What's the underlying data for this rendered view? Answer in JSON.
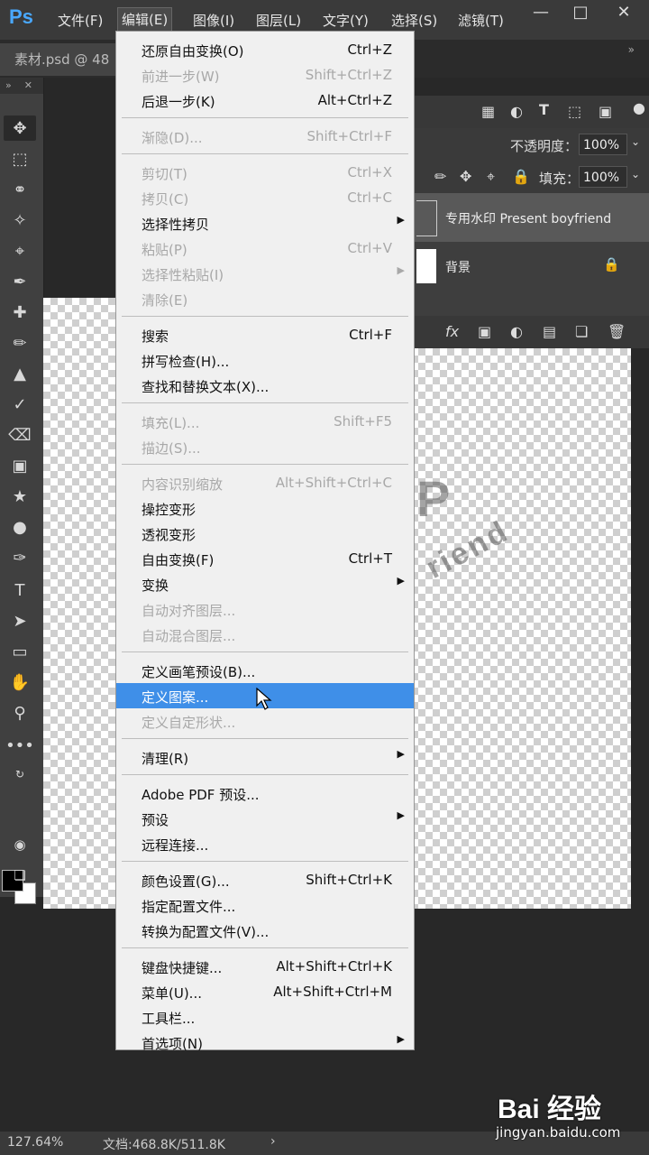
{
  "app": {
    "logo": "Ps"
  },
  "menubar": {
    "items": [
      "文件(F)",
      "编辑(E)",
      "图像(I)",
      "图层(L)",
      "文字(Y)",
      "选择(S)",
      "滤镜(T)"
    ],
    "window_controls": [
      "minimize-icon",
      "maximize-icon",
      "close-icon"
    ]
  },
  "document_tab": {
    "title": "素材.psd @ 48"
  },
  "toolbar": {
    "tools": [
      "move-icon",
      "marquee-icon",
      "lasso-icon",
      "magic-wand-icon",
      "crop-icon",
      "eyedropper-icon",
      "healing-icon",
      "brush-icon",
      "stamp-icon",
      "history-brush-icon",
      "eraser-icon",
      "gradient-icon",
      "blur-icon",
      "dodge-icon",
      "pen-icon",
      "type-icon",
      "path-selection-icon",
      "rectangle-icon",
      "hand-icon",
      "zoom-icon",
      "more-icon"
    ],
    "text_tool_label": "T",
    "foreground_color": "#000000",
    "background_color": "#ffffff"
  },
  "layers_panel": {
    "opacity_label": "不透明度：",
    "opacity_value": "100%",
    "fill_label": "填充：",
    "fill_value": "100%",
    "layers": [
      {
        "name": "专用水印 Present boyfriend",
        "selected": true
      },
      {
        "name": "背景",
        "locked": true
      }
    ]
  },
  "canvas": {
    "watermark_text": "riend"
  },
  "edit_menu": {
    "groups": [
      [
        {
          "label": "还原自由变换(O)",
          "shortcut": "Ctrl+Z",
          "enabled": true
        },
        {
          "label": "前进一步(W)",
          "shortcut": "Shift+Ctrl+Z",
          "enabled": false
        },
        {
          "label": "后退一步(K)",
          "shortcut": "Alt+Ctrl+Z",
          "enabled": true
        }
      ],
      [
        {
          "label": "渐隐(D)...",
          "shortcut": "Shift+Ctrl+F",
          "enabled": false
        }
      ],
      [
        {
          "label": "剪切(T)",
          "shortcut": "Ctrl+X",
          "enabled": false
        },
        {
          "label": "拷贝(C)",
          "shortcut": "Ctrl+C",
          "enabled": false
        },
        {
          "label": "选择性拷贝",
          "submenu": true,
          "enabled": true
        },
        {
          "label": "粘贴(P)",
          "shortcut": "Ctrl+V",
          "enabled": false
        },
        {
          "label": "选择性粘贴(I)",
          "submenu": true,
          "enabled": false
        },
        {
          "label": "清除(E)",
          "enabled": false
        }
      ],
      [
        {
          "label": "搜索",
          "shortcut": "Ctrl+F",
          "enabled": true
        },
        {
          "label": "拼写检查(H)...",
          "enabled": true
        },
        {
          "label": "查找和替换文本(X)...",
          "enabled": true
        }
      ],
      [
        {
          "label": "填充(L)...",
          "shortcut": "Shift+F5",
          "enabled": false
        },
        {
          "label": "描边(S)...",
          "enabled": false
        }
      ],
      [
        {
          "label": "内容识别缩放",
          "shortcut": "Alt+Shift+Ctrl+C",
          "enabled": false
        },
        {
          "label": "操控变形",
          "enabled": true
        },
        {
          "label": "透视变形",
          "enabled": true
        },
        {
          "label": "自由变换(F)",
          "shortcut": "Ctrl+T",
          "enabled": true
        },
        {
          "label": "变换",
          "submenu": true,
          "enabled": true
        },
        {
          "label": "自动对齐图层...",
          "enabled": false
        },
        {
          "label": "自动混合图层...",
          "enabled": false
        }
      ],
      [
        {
          "label": "定义画笔预设(B)...",
          "enabled": true
        },
        {
          "label": "定义图案...",
          "enabled": true,
          "highlighted": true
        },
        {
          "label": "定义自定形状...",
          "enabled": false
        }
      ],
      [
        {
          "label": "清理(R)",
          "submenu": true,
          "enabled": true
        }
      ],
      [
        {
          "label": "Adobe PDF 预设...",
          "enabled": true
        },
        {
          "label": "预设",
          "submenu": true,
          "enabled": true
        },
        {
          "label": "远程连接...",
          "enabled": true
        }
      ],
      [
        {
          "label": "颜色设置(G)...",
          "shortcut": "Shift+Ctrl+K",
          "enabled": true
        },
        {
          "label": "指定配置文件...",
          "enabled": true
        },
        {
          "label": "转换为配置文件(V)...",
          "enabled": true
        }
      ],
      [
        {
          "label": "键盘快捷键...",
          "shortcut": "Alt+Shift+Ctrl+K",
          "enabled": true
        },
        {
          "label": "菜单(U)...",
          "shortcut": "Alt+Shift+Ctrl+M",
          "enabled": true
        },
        {
          "label": "工具栏...",
          "enabled": true
        },
        {
          "label": "首选项(N)",
          "submenu": true,
          "enabled": true
        }
      ]
    ]
  },
  "statusbar": {
    "zoom": "127.64%",
    "doc_info": "文档:468.8K/511.8K"
  },
  "watermark": {
    "brand": "Bai 经验",
    "url": "jingyan.baidu.com"
  }
}
